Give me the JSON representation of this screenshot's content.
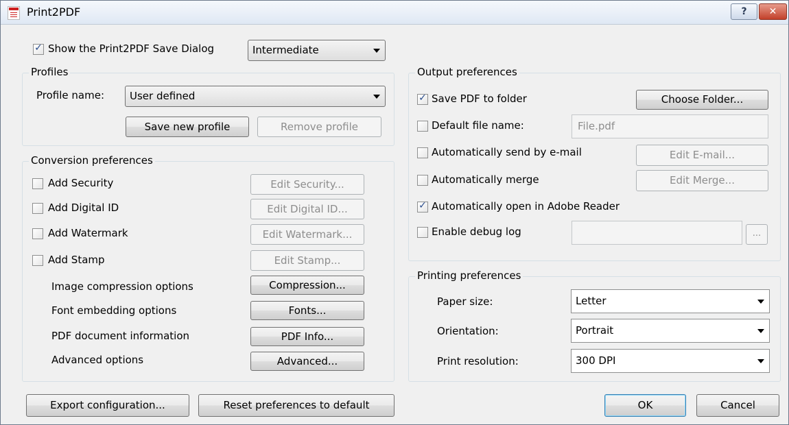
{
  "window": {
    "title": "Print2PDF",
    "help_label": "?",
    "close_label": "✕"
  },
  "top": {
    "show_dialog_checked": true,
    "show_dialog_label": "Show the Print2PDF Save Dialog",
    "level_value": "Intermediate"
  },
  "profiles": {
    "title": "Profiles",
    "name_label": "Profile name:",
    "name_value": "User defined",
    "save_label": "Save new profile",
    "remove_label": "Remove profile"
  },
  "conversion": {
    "title": "Conversion preferences",
    "checks": [
      {
        "label": "Add Security",
        "checked": false,
        "button": "Edit Security..."
      },
      {
        "label": "Add Digital ID",
        "checked": false,
        "button": "Edit Digital ID..."
      },
      {
        "label": "Add Watermark",
        "checked": false,
        "button": "Edit Watermark..."
      },
      {
        "label": "Add Stamp",
        "checked": false,
        "button": "Edit Stamp..."
      }
    ],
    "options": [
      {
        "label": "Image compression options",
        "button": "Compression..."
      },
      {
        "label": "Font embedding options",
        "button": "Fonts..."
      },
      {
        "label": "PDF document information",
        "button": "PDF Info..."
      },
      {
        "label": "Advanced options",
        "button": "Advanced..."
      }
    ]
  },
  "output": {
    "title": "Output preferences",
    "save_folder_label": "Save PDF to folder",
    "save_folder_checked": true,
    "choose_folder_label": "Choose Folder...",
    "default_name_label": "Default file name:",
    "default_name_checked": false,
    "default_name_value": "File.pdf",
    "email_label": "Automatically send by e-mail",
    "email_checked": false,
    "email_button": "Edit E-mail...",
    "merge_label": "Automatically merge",
    "merge_checked": false,
    "merge_button": "Edit Merge...",
    "open_reader_label": "Automatically open in Adobe Reader",
    "open_reader_checked": true,
    "debug_label": "Enable debug log",
    "debug_checked": false,
    "debug_path_value": "",
    "browse_label": "..."
  },
  "printing": {
    "title": "Printing preferences",
    "paper_label": "Paper size:",
    "paper_value": "Letter",
    "orientation_label": "Orientation:",
    "orientation_value": "Portrait",
    "resolution_label": "Print resolution:",
    "resolution_value": "300 DPI"
  },
  "footer": {
    "export_label": "Export configuration...",
    "reset_label": "Reset preferences to default",
    "ok_label": "OK",
    "cancel_label": "Cancel"
  },
  "icons": {
    "app": "pdf-document-icon",
    "help": "help-icon",
    "close": "close-icon",
    "dropdown": "chevron-down-icon",
    "check": "checkmark-icon"
  }
}
